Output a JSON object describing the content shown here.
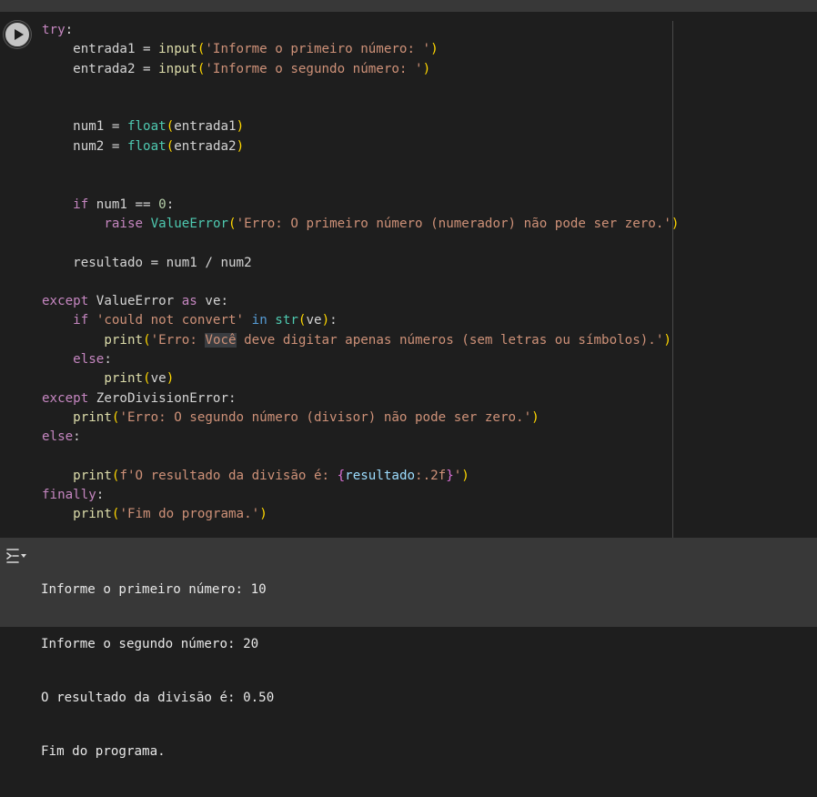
{
  "cell": {
    "code_lines": [
      {
        "segments": [
          {
            "t": "try",
            "c": "kw"
          },
          {
            "t": ":",
            "c": ""
          }
        ]
      },
      {
        "segments": [
          {
            "t": "    entrada1 = ",
            "c": ""
          },
          {
            "t": "input",
            "c": "fn"
          },
          {
            "t": "(",
            "c": "p1"
          },
          {
            "t": "'Informe o primeiro número: '",
            "c": "str"
          },
          {
            "t": ")",
            "c": "p1"
          }
        ]
      },
      {
        "segments": [
          {
            "t": "    entrada2 = ",
            "c": ""
          },
          {
            "t": "input",
            "c": "fn"
          },
          {
            "t": "(",
            "c": "p1"
          },
          {
            "t": "'Informe o segundo número: '",
            "c": "str"
          },
          {
            "t": ")",
            "c": "p1"
          }
        ]
      },
      {
        "segments": []
      },
      {
        "segments": []
      },
      {
        "segments": [
          {
            "t": "    num1 = ",
            "c": ""
          },
          {
            "t": "float",
            "c": "bi"
          },
          {
            "t": "(",
            "c": "p1"
          },
          {
            "t": "entrada1",
            "c": ""
          },
          {
            "t": ")",
            "c": "p1"
          }
        ]
      },
      {
        "segments": [
          {
            "t": "    num2 = ",
            "c": ""
          },
          {
            "t": "float",
            "c": "bi"
          },
          {
            "t": "(",
            "c": "p1"
          },
          {
            "t": "entrada2",
            "c": ""
          },
          {
            "t": ")",
            "c": "p1"
          }
        ]
      },
      {
        "segments": []
      },
      {
        "segments": []
      },
      {
        "segments": [
          {
            "t": "    ",
            "c": ""
          },
          {
            "t": "if",
            "c": "kw"
          },
          {
            "t": " num1 == ",
            "c": ""
          },
          {
            "t": "0",
            "c": "num"
          },
          {
            "t": ":",
            "c": ""
          }
        ]
      },
      {
        "segments": [
          {
            "t": "        ",
            "c": ""
          },
          {
            "t": "raise",
            "c": "kw"
          },
          {
            "t": " ",
            "c": ""
          },
          {
            "t": "ValueError",
            "c": "bi"
          },
          {
            "t": "(",
            "c": "p1"
          },
          {
            "t": "'Erro: O primeiro número (numerador) não pode ser zero.'",
            "c": "str"
          },
          {
            "t": ")",
            "c": "p1"
          }
        ]
      },
      {
        "segments": []
      },
      {
        "segments": [
          {
            "t": "    resultado = num1 / num2",
            "c": ""
          }
        ]
      },
      {
        "segments": []
      },
      {
        "segments": [
          {
            "t": "except",
            "c": "kw"
          },
          {
            "t": " ",
            "c": ""
          },
          {
            "t": "ValueError",
            "c": ""
          },
          {
            "t": " ",
            "c": ""
          },
          {
            "t": "as",
            "c": "kw"
          },
          {
            "t": " ve:",
            "c": ""
          }
        ]
      },
      {
        "segments": [
          {
            "t": "    ",
            "c": ""
          },
          {
            "t": "if",
            "c": "kw"
          },
          {
            "t": " ",
            "c": ""
          },
          {
            "t": "'could not convert'",
            "c": "str"
          },
          {
            "t": " ",
            "c": ""
          },
          {
            "t": "in",
            "c": "kw2"
          },
          {
            "t": " ",
            "c": ""
          },
          {
            "t": "str",
            "c": "bi"
          },
          {
            "t": "(",
            "c": "p1"
          },
          {
            "t": "ve",
            "c": ""
          },
          {
            "t": ")",
            "c": "p1"
          },
          {
            "t": ":",
            "c": ""
          }
        ]
      },
      {
        "segments": [
          {
            "t": "        ",
            "c": ""
          },
          {
            "t": "print",
            "c": "fn"
          },
          {
            "t": "(",
            "c": "p1"
          },
          {
            "t": "'Erro: ",
            "c": "str"
          },
          {
            "t": "Você",
            "c": "str hl"
          },
          {
            "t": " deve digitar apenas números (sem letras ou símbolos).'",
            "c": "str"
          },
          {
            "t": ")",
            "c": "p1"
          }
        ]
      },
      {
        "segments": [
          {
            "t": "    ",
            "c": ""
          },
          {
            "t": "else",
            "c": "kw"
          },
          {
            "t": ":",
            "c": ""
          }
        ]
      },
      {
        "segments": [
          {
            "t": "        ",
            "c": ""
          },
          {
            "t": "print",
            "c": "fn"
          },
          {
            "t": "(",
            "c": "p1"
          },
          {
            "t": "ve",
            "c": ""
          },
          {
            "t": ")",
            "c": "p1"
          }
        ]
      },
      {
        "segments": [
          {
            "t": "except",
            "c": "kw"
          },
          {
            "t": " ZeroDivisionError:",
            "c": ""
          }
        ]
      },
      {
        "segments": [
          {
            "t": "    ",
            "c": ""
          },
          {
            "t": "print",
            "c": "fn"
          },
          {
            "t": "(",
            "c": "p1"
          },
          {
            "t": "'Erro: O segundo número (divisor) não pode ser zero.'",
            "c": "str"
          },
          {
            "t": ")",
            "c": "p1"
          }
        ]
      },
      {
        "segments": [
          {
            "t": "else",
            "c": "kw"
          },
          {
            "t": ":",
            "c": ""
          }
        ]
      },
      {
        "segments": []
      },
      {
        "segments": [
          {
            "t": "    ",
            "c": ""
          },
          {
            "t": "print",
            "c": "fn"
          },
          {
            "t": "(",
            "c": "p1"
          },
          {
            "t": "f'O resultado da divisão é: ",
            "c": "str"
          },
          {
            "t": "{",
            "c": "p2"
          },
          {
            "t": "resultado",
            "c": "fv"
          },
          {
            "t": ":.2f",
            "c": "str"
          },
          {
            "t": "}",
            "c": "p2"
          },
          {
            "t": "'",
            "c": "str"
          },
          {
            "t": ")",
            "c": "p1"
          }
        ]
      },
      {
        "segments": [
          {
            "t": "finally",
            "c": "kw"
          },
          {
            "t": ":",
            "c": ""
          }
        ]
      },
      {
        "segments": [
          {
            "t": "    ",
            "c": ""
          },
          {
            "t": "print",
            "c": "fn"
          },
          {
            "t": "(",
            "c": "p1"
          },
          {
            "t": "'Fim do programa.'",
            "c": "str"
          },
          {
            "t": ")",
            "c": "p1"
          }
        ]
      }
    ]
  },
  "output": {
    "lines": [
      "Informe o primeiro número: 10",
      "Informe o segundo número: 20",
      "O resultado da divisão é: 0.50",
      "Fim do programa."
    ]
  },
  "icons": {
    "run": "play-icon",
    "output": "output-toggle-icon"
  },
  "colors": {
    "editor_bg": "#1e1e1e",
    "output_bg": "#383838",
    "keyword": "#c586c0",
    "function": "#dcdcaa",
    "builtin": "#4ec9b0",
    "string": "#ce9178",
    "number": "#b5cea8",
    "bracket": "#ffd700"
  }
}
